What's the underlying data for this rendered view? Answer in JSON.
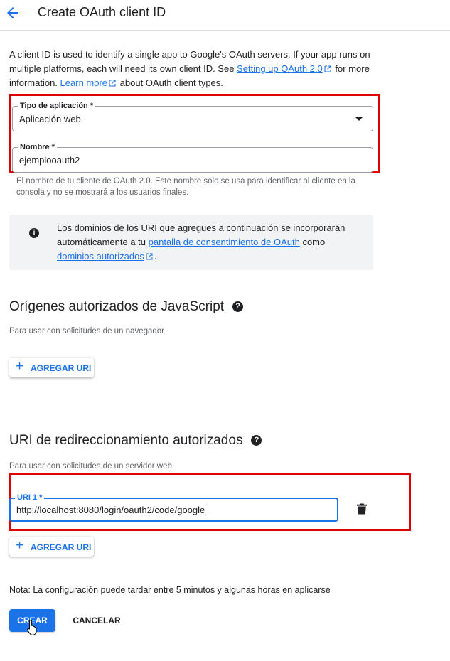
{
  "header": {
    "title": "Create OAuth client ID",
    "back_icon": "arrow-back-icon"
  },
  "intro": {
    "text_1": "A client ID is used to identify a single app to Google's OAuth servers. If your app runs on multiple platforms, each will need its own client ID. See ",
    "link_setup": "Setting up OAuth 2.0",
    "text_2": " for more information. ",
    "link_learn": "Learn more",
    "text_3": " about OAuth client types."
  },
  "form": {
    "app_type": {
      "label": "Tipo de aplicación *",
      "value": "Aplicación web"
    },
    "name": {
      "label": "Nombre *",
      "value": "ejemplooauth2"
    },
    "name_hint": "El nombre de tu cliente de OAuth 2.0. Este nombre solo se usa para identificar al cliente en la consola y no se mostrará a los usuarios finales."
  },
  "info_box": {
    "text_1": "Los dominios de los URI que agregues a continuación se incorporarán automáticamente a tu ",
    "link_consent": "pantalla de consentimiento de OAuth",
    "text_2": " como ",
    "link_domains": "dominios autorizados",
    "text_3": "."
  },
  "js_origins": {
    "title": "Orígenes autorizados de JavaScript",
    "subtitle": "Para usar con solicitudes de un navegador",
    "add_label": "AGREGAR URI"
  },
  "redirect_uris": {
    "title": "URI de redireccionamiento autorizados",
    "subtitle": "Para usar con solicitudes de un servidor web",
    "uri_label": "URI 1 *",
    "uri_value": "http://localhost:8080/login/oauth2/code/google",
    "add_label": "AGREGAR URI"
  },
  "footer": {
    "note": "Nota: La configuración puede tardar entre 5 minutos y algunas horas en aplicarse",
    "create_label": "CREAR",
    "cancel_label": "CANCELAR"
  },
  "colors": {
    "accent": "#1a73e8",
    "highlight": "#e00000"
  }
}
